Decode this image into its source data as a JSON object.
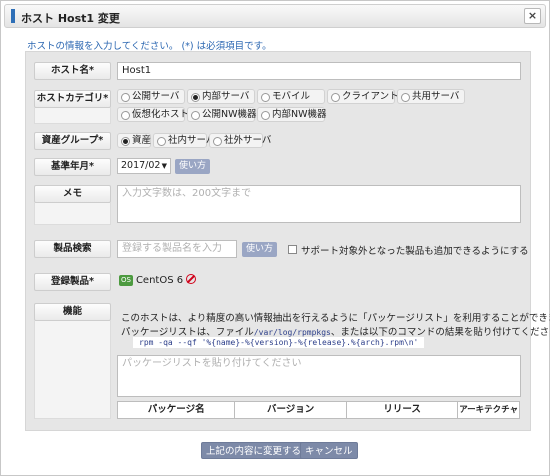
{
  "dialog": {
    "title": "ホスト Host1 変更",
    "close_label": "×"
  },
  "instruction": "ホストの情報を入力してください。 (*) は必須項目です。",
  "form": {
    "host_name": {
      "label": "ホスト名*",
      "value": "Host1"
    },
    "host_category": {
      "label": "ホストカテゴリ*",
      "options": [
        "公開サーバ",
        "内部サーバ",
        "モバイル",
        "クライアント",
        "共用サーバ",
        "仮想化ホスト",
        "公開NW機器",
        "内部NW機器"
      ],
      "selected": "内部サーバ"
    },
    "asset_group": {
      "label": "資産グループ*",
      "options": [
        "資産",
        "社内サーバ",
        "社外サーバ"
      ],
      "selected": "資産"
    },
    "base_year_month": {
      "label": "基準年月*",
      "value": "2017/02",
      "help_label": "使い方"
    },
    "memo": {
      "label": "メモ",
      "placeholder": "入力文字数は、200文字まで"
    },
    "product_search": {
      "label": "製品検索",
      "placeholder": "登録する製品名を入力",
      "help_label": "使い方",
      "include_unsupported_label": "サポート対象外となった製品も追加できるようにする",
      "include_unsupported_checked": false
    },
    "registered_products": {
      "label": "登録製品*",
      "items": [
        {
          "badge": "OS",
          "name": "CentOS 6"
        }
      ]
    },
    "feature": {
      "label": "機能",
      "description_line1": "このホストは、より精度の高い情報抽出を行えるように「パッケージリスト」を利用することができます。",
      "description_line2_prefix": "パッケージリストは、ファイル",
      "description_line2_path": "/var/log/rpmpkgs",
      "description_line2_suffix": "、または以下のコマンドの結果を貼り付けてください。",
      "command": "rpm -qa --qf '%{name}-%{version}-%{release}.%{arch}.rpm\\n'",
      "package_list_placeholder": "パッケージリストを貼り付けてください",
      "table_headers": [
        "パッケージ名",
        "バージョン",
        "リリース",
        "アーキテクチャ"
      ]
    }
  },
  "footer": {
    "submit_label": "上記の内容に変更する",
    "cancel_label": "キャンセル"
  }
}
